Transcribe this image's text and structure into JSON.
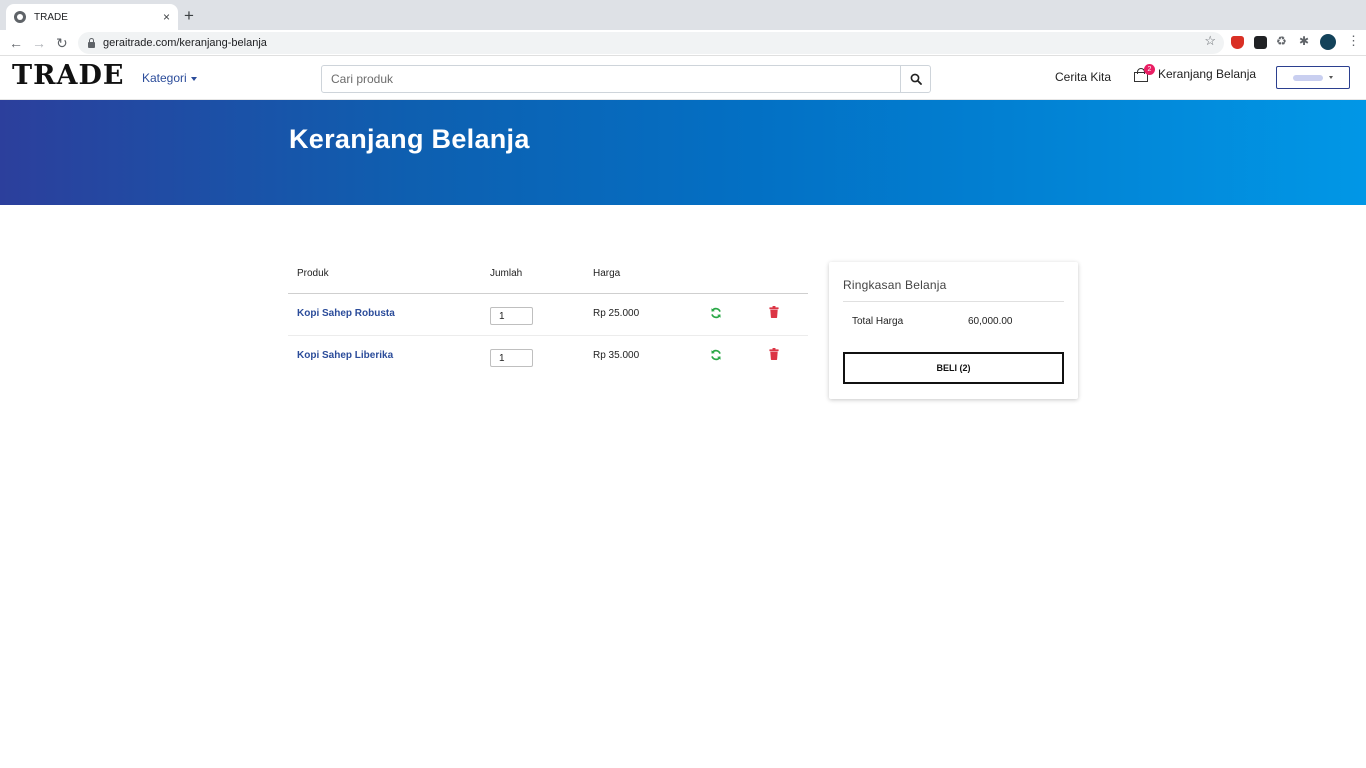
{
  "browser": {
    "tab_title": "TRADE",
    "tab_close": "×",
    "new_tab": "+",
    "url": "geraitrade.com/keranjang-belanja"
  },
  "navbar": {
    "brand": "TRADE",
    "kategori_label": "Kategori",
    "search_placeholder": "Cari produk",
    "search_value": "",
    "cerita_label": "Cerita Kita",
    "cart_label": "Keranjang Belanja",
    "cart_count": "2"
  },
  "hero": {
    "title": "Keranjang Belanja"
  },
  "cart": {
    "headers": [
      "Produk",
      "Jumlah",
      "Harga"
    ],
    "items": [
      {
        "name": "Kopi Sahep Robusta",
        "qty": "1",
        "price": "Rp 25.000"
      },
      {
        "name": "Kopi Sahep Liberika",
        "qty": "1",
        "price": "Rp 35.000"
      }
    ]
  },
  "summary": {
    "title": "Ringkasan Belanja",
    "total_label": "Total Harga",
    "total_value": "60,000.00",
    "buy_label": "BELI (2)"
  },
  "colors": {
    "link": "#2b4c9a",
    "refresh": "#28a745",
    "trash": "#dc3545",
    "badge": "#e91e63",
    "hero_start": "#2c3f9c",
    "hero_end": "#0197e6"
  }
}
